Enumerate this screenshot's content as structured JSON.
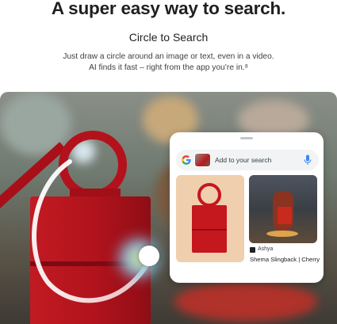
{
  "hero": {
    "headline": "A super easy way to search.",
    "subheading": "Circle to Search",
    "description_line1": "Just draw a circle around an image or text, even in a video.",
    "description_line2": "AI finds it fast – right from the app you’re in.⁸"
  },
  "search_overlay": {
    "placeholder": "Add to your search",
    "results": [
      {
        "source": "",
        "title": ""
      },
      {
        "source": "Ashya",
        "title": "Shema Slingback | Cherry"
      }
    ]
  },
  "colors": {
    "bag_red": "#b3121c",
    "card_bg": "#ffffff",
    "search_field_bg": "#f1f3f4",
    "circle_glow": "#ffffff"
  },
  "icons": {
    "search_bar_left": "google-g-icon",
    "search_bar_right": "microphone-icon",
    "result_source": "source-favicon-icon"
  }
}
